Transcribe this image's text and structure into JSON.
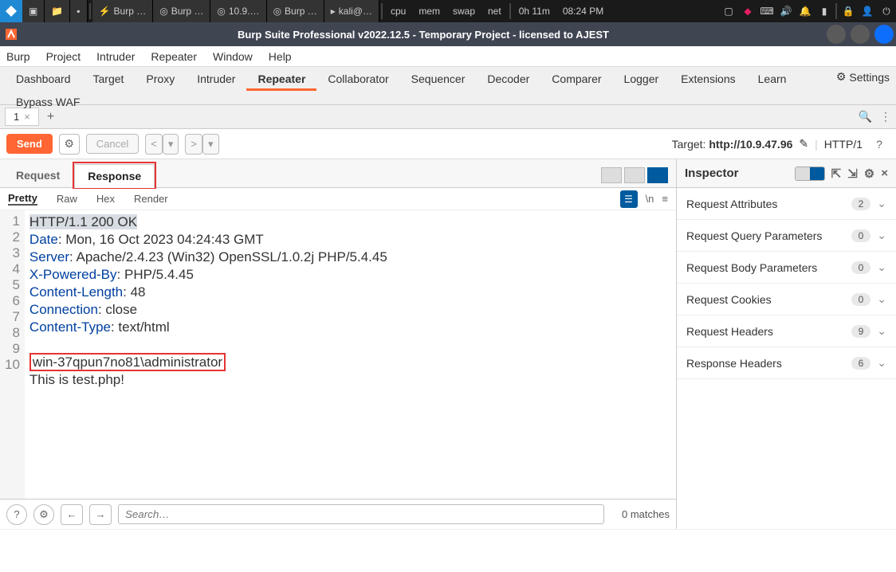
{
  "taskbar": {
    "apps": [
      "Burp …",
      "Burp …",
      "10.9.…",
      "Burp …",
      "kali@…"
    ],
    "meters": [
      "cpu",
      "mem",
      "swap",
      "net"
    ],
    "uptime": "0h 11m",
    "clock": "08:24 PM"
  },
  "window": {
    "title": "Burp Suite Professional v2022.12.5 - Temporary Project - licensed to AJEST"
  },
  "menubar": [
    "Burp",
    "Project",
    "Intruder",
    "Repeater",
    "Window",
    "Help"
  ],
  "maintabs": {
    "row1": [
      "Dashboard",
      "Target",
      "Proxy",
      "Intruder",
      "Repeater",
      "Collaborator",
      "Sequencer",
      "Decoder",
      "Comparer",
      "Logger",
      "Extensions",
      "Learn"
    ],
    "row2": [
      "Bypass WAF"
    ],
    "active": "Repeater",
    "settings": "Settings"
  },
  "subtab": {
    "label": "1"
  },
  "action": {
    "send": "Send",
    "cancel": "Cancel",
    "target_label": "Target: ",
    "target_value": "http://10.9.47.96",
    "protocol": "HTTP/1"
  },
  "rr": {
    "request": "Request",
    "response": "Response",
    "active": "Response"
  },
  "fmt": {
    "tabs": [
      "Pretty",
      "Raw",
      "Hex",
      "Render"
    ],
    "active": "Pretty"
  },
  "response": {
    "status": "HTTP/1.1 200 OK",
    "headers": [
      {
        "name": "Date",
        "value": "Mon, 16 Oct 2023 04:24:43 GMT"
      },
      {
        "name": "Server",
        "value": "Apache/2.4.23 (Win32) OpenSSL/1.0.2j PHP/5.4.45"
      },
      {
        "name": "X-Powered-By",
        "value": "PHP/5.4.45"
      },
      {
        "name": "Content-Length",
        "value": "48"
      },
      {
        "name": "Connection",
        "value": "close"
      },
      {
        "name": "Content-Type",
        "value": "text/html"
      }
    ],
    "body_highlight": "win-37qpun7no81\\administrator",
    "body_rest": "This is test.php!"
  },
  "search": {
    "placeholder": "Search…",
    "matches": "0 matches"
  },
  "inspector": {
    "title": "Inspector",
    "rows": [
      {
        "label": "Request Attributes",
        "count": "2"
      },
      {
        "label": "Request Query Parameters",
        "count": "0"
      },
      {
        "label": "Request Body Parameters",
        "count": "0"
      },
      {
        "label": "Request Cookies",
        "count": "0"
      },
      {
        "label": "Request Headers",
        "count": "9"
      },
      {
        "label": "Response Headers",
        "count": "6"
      }
    ]
  },
  "status": {
    "left": "",
    "right": ""
  }
}
